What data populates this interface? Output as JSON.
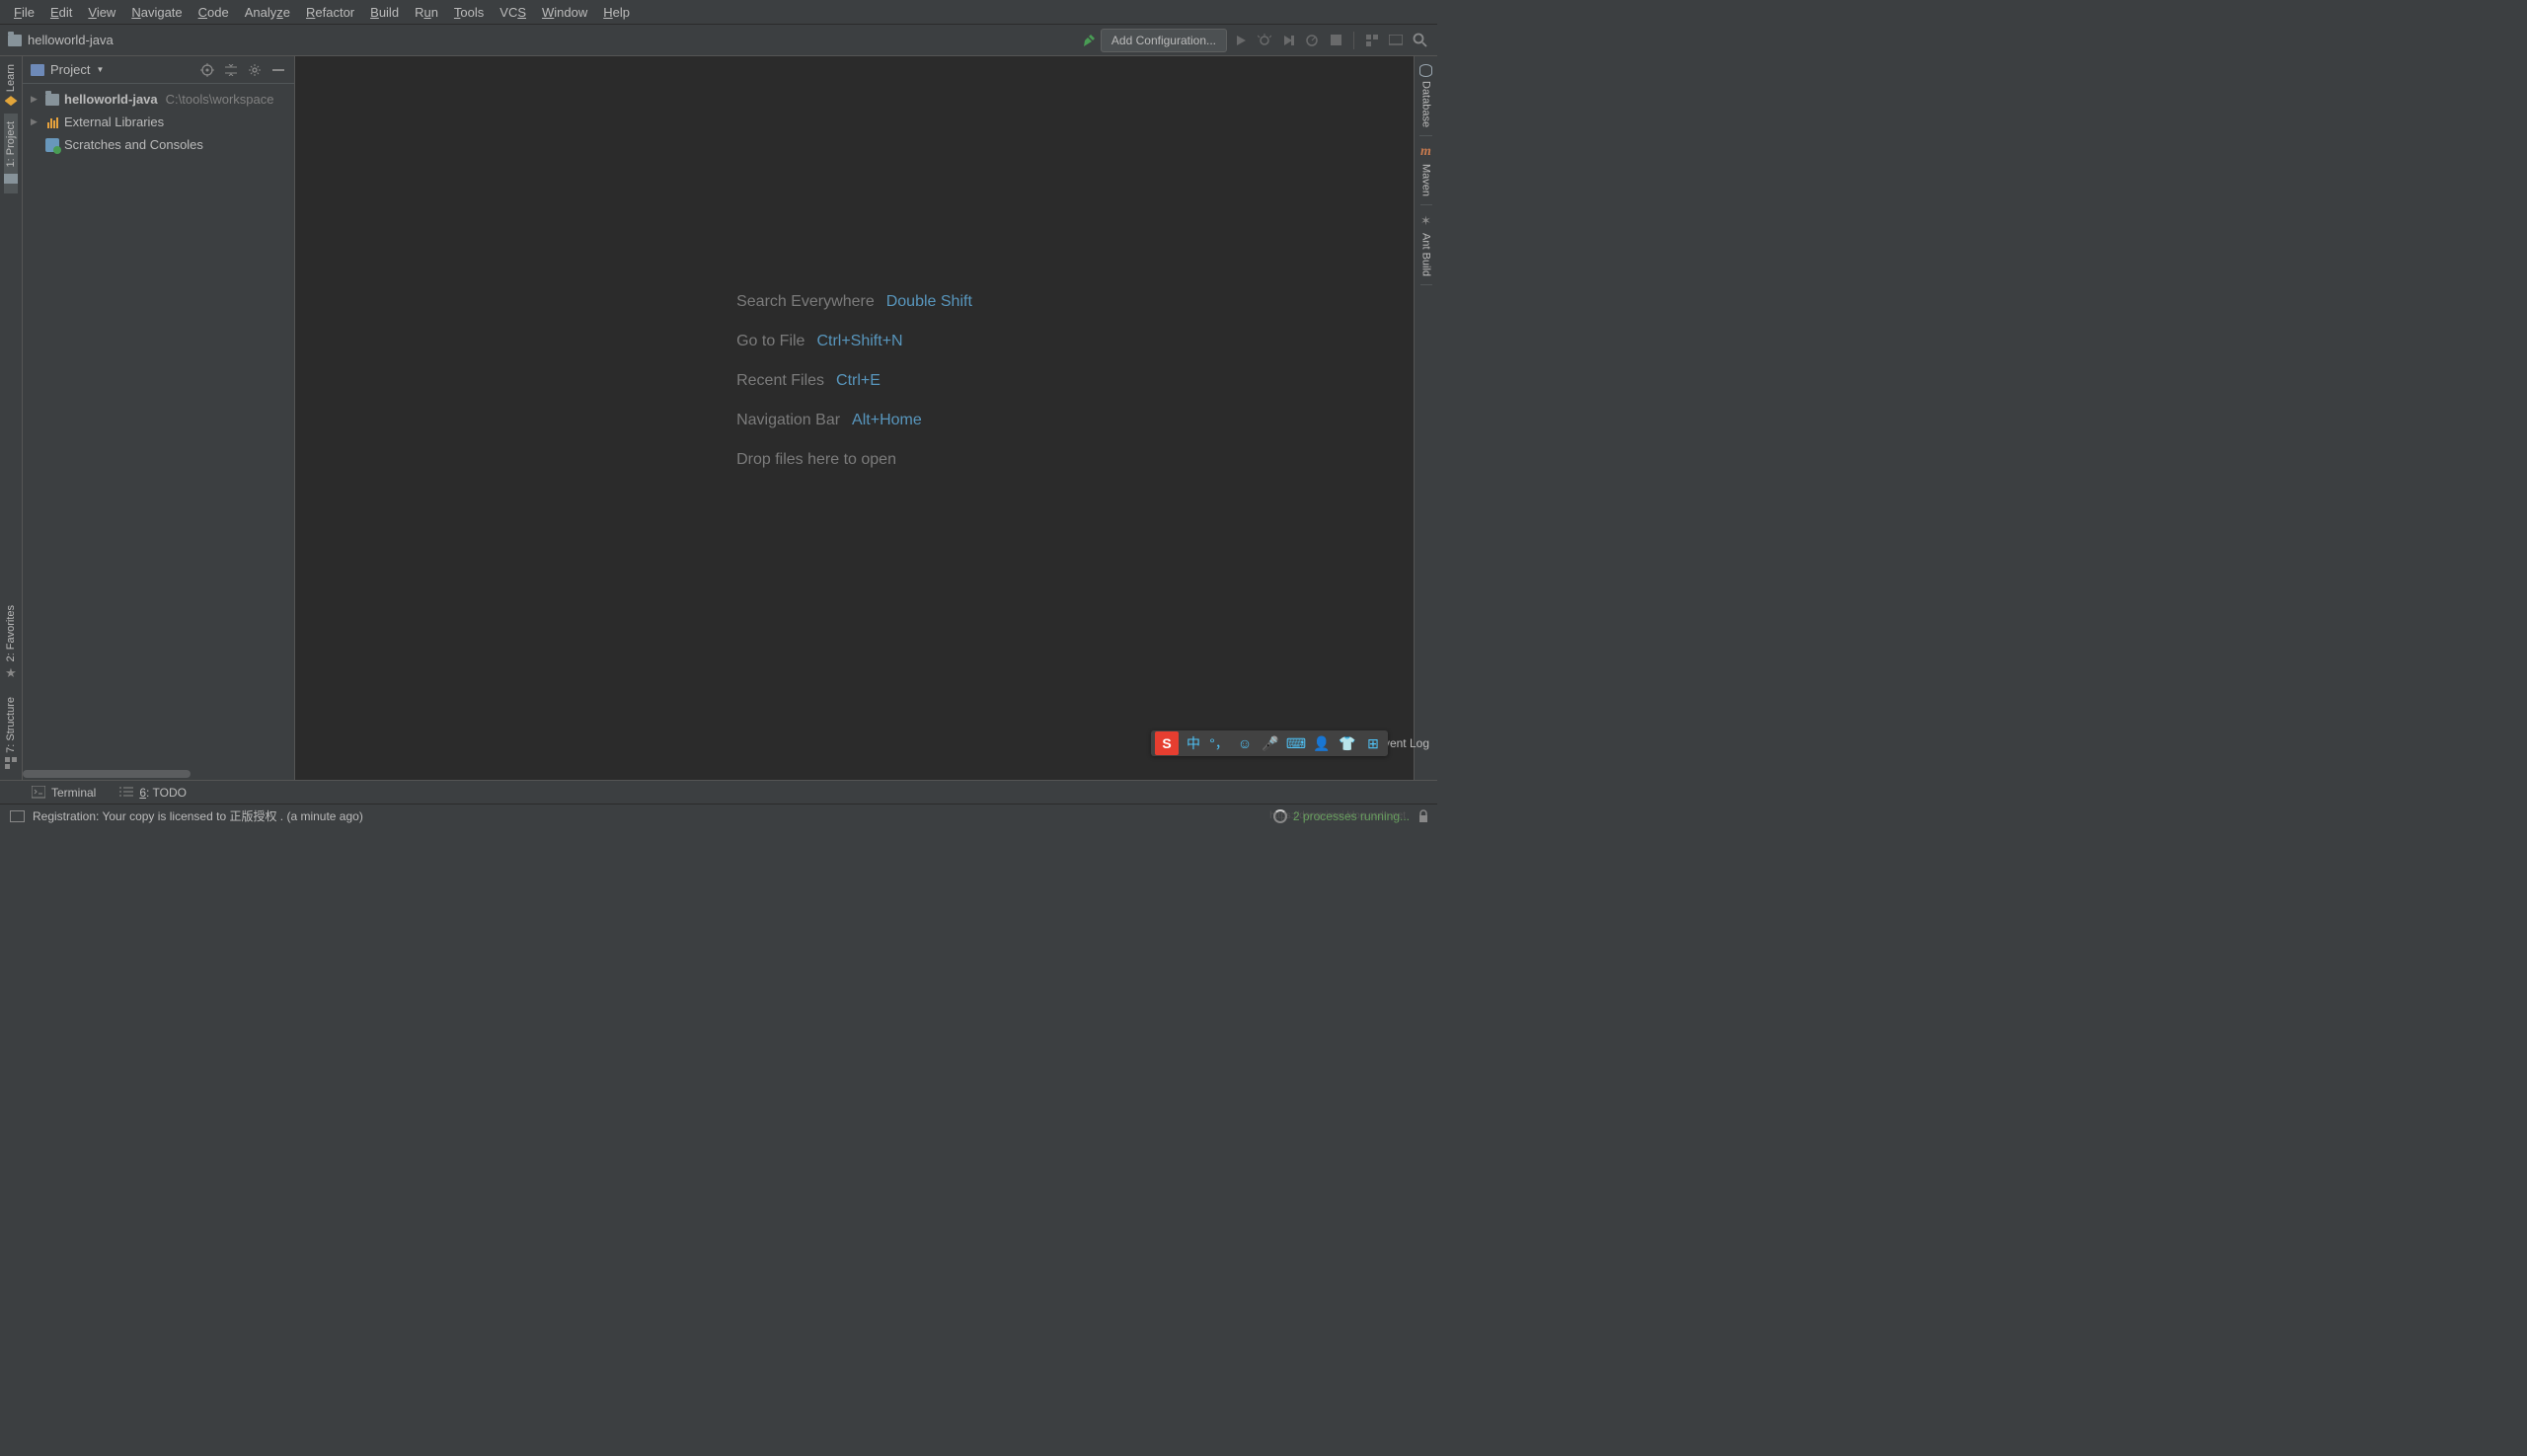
{
  "menu": [
    "File",
    "Edit",
    "View",
    "Navigate",
    "Code",
    "Analyze",
    "Refactor",
    "Build",
    "Run",
    "Tools",
    "VCS",
    "Window",
    "Help"
  ],
  "menu_mnemonic_index": [
    0,
    0,
    0,
    0,
    0,
    5,
    0,
    0,
    1,
    0,
    2,
    0,
    0
  ],
  "breadcrumb": {
    "project": "helloworld-java"
  },
  "toolbar": {
    "config": "Add Configuration..."
  },
  "project_panel": {
    "title": "Project",
    "items": [
      {
        "label": "helloworld-java",
        "path": "C:\\tools\\workspace",
        "type": "project"
      },
      {
        "label": "External Libraries",
        "type": "lib"
      },
      {
        "label": "Scratches and Consoles",
        "type": "scratch"
      }
    ]
  },
  "left_gutter": {
    "learn": "Learn",
    "project": "1: Project",
    "favorites": "2: Favorites",
    "structure": "7: Structure"
  },
  "right_gutter": {
    "database": "Database",
    "maven": "Maven",
    "ant": "Ant Build"
  },
  "hints": [
    {
      "label": "Search Everywhere",
      "key": "Double Shift"
    },
    {
      "label": "Go to File",
      "key": "Ctrl+Shift+N"
    },
    {
      "label": "Recent Files",
      "key": "Ctrl+E"
    },
    {
      "label": "Navigation Bar",
      "key": "Alt+Home"
    },
    {
      "label": "Drop files here to open",
      "key": ""
    }
  ],
  "bottom_tabs": {
    "terminal": "Terminal",
    "todo": "6: TODO",
    "event_log": "Event Log"
  },
  "status": {
    "text": "Registration: Your copy is licensed to 正版授权 . (a minute ago)",
    "processes": "2 processes running...",
    "watermark": "https://dongyimai.blog.csdn.net"
  },
  "ime": {
    "logo": "S",
    "lang": "中"
  }
}
